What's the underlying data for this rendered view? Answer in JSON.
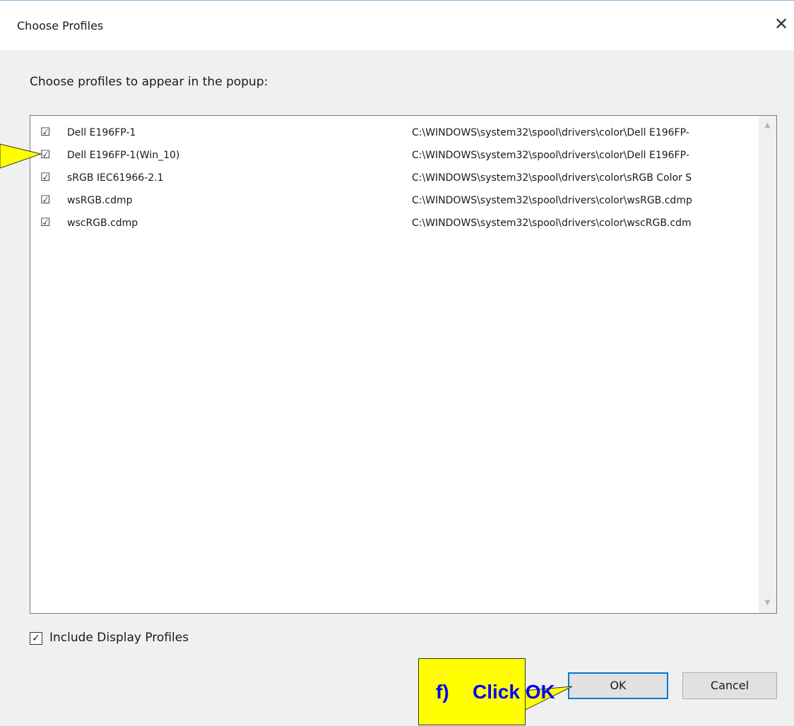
{
  "dialog": {
    "title": "Choose Profiles",
    "close_glyph": "✕",
    "instruction": "Choose profiles to appear in the popup:",
    "checkbox_glyph": "☑",
    "profiles": [
      {
        "name": "Dell E196FP-1",
        "path": "C:\\WINDOWS\\system32\\spool\\drivers\\color\\Dell E196FP-",
        "checked": true
      },
      {
        "name": "Dell E196FP-1(Win_10)",
        "path": "C:\\WINDOWS\\system32\\spool\\drivers\\color\\Dell E196FP-",
        "checked": true
      },
      {
        "name": "sRGB IEC61966-2.1",
        "path": "C:\\WINDOWS\\system32\\spool\\drivers\\color\\sRGB Color S",
        "checked": true
      },
      {
        "name": "wsRGB.cdmp",
        "path": "C:\\WINDOWS\\system32\\spool\\drivers\\color\\wsRGB.cdmp",
        "checked": true
      },
      {
        "name": "wscRGB.cdmp",
        "path": "C:\\WINDOWS\\system32\\spool\\drivers\\color\\wscRGB.cdm",
        "checked": true
      }
    ],
    "include_display_profiles": {
      "label": "Include Display Profiles",
      "checked": true,
      "glyph": "✓"
    },
    "buttons": {
      "ok": "OK",
      "cancel": "Cancel"
    },
    "scroll_glyphs": {
      "up": "▲",
      "down": "▼"
    }
  },
  "annotation": {
    "letter": "f)",
    "message": "Click OK",
    "fill_color": "#ffff00",
    "text_color": "#0000ff"
  }
}
